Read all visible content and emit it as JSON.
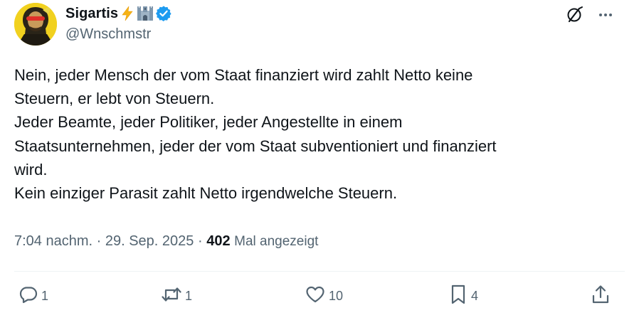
{
  "author": {
    "display_name": "Sigartis",
    "emoji_1": "⚡",
    "emoji_2": "🏰",
    "verified": true,
    "handle": "@Wnschmstr"
  },
  "post": {
    "text": "Nein, jeder Mensch der vom Staat finanziert wird zahlt Netto keine\nSteuern, er lebt von Steuern.\nJeder Beamte, jeder Politiker, jeder Angestellte in einem\nStaatsunternehmen, jeder der vom Staat subventioniert und finanziert\nwird.\nKein einziger Parasit zahlt Netto irgendwelche Steuern."
  },
  "meta": {
    "time": "7:04 nachm.",
    "separator_1": " · ",
    "date": "29. Sep. 2025",
    "separator_2": " · ",
    "views": "402",
    "views_label": "Mal angezeigt"
  },
  "actions": {
    "reply_count": "1",
    "repost_count": "1",
    "like_count": "10",
    "bookmark_count": "4"
  },
  "icons": {
    "grok": "grok-icon",
    "more": "more-icon",
    "reply": "reply-icon",
    "repost": "repost-icon",
    "like": "like-icon",
    "bookmark": "bookmark-icon",
    "share": "share-icon"
  },
  "colors": {
    "text": "#0f1419",
    "secondary": "#536471",
    "verified": "#1d9bf0",
    "divider": "#eff3f4",
    "avatar_bg": "#f3d21b"
  }
}
